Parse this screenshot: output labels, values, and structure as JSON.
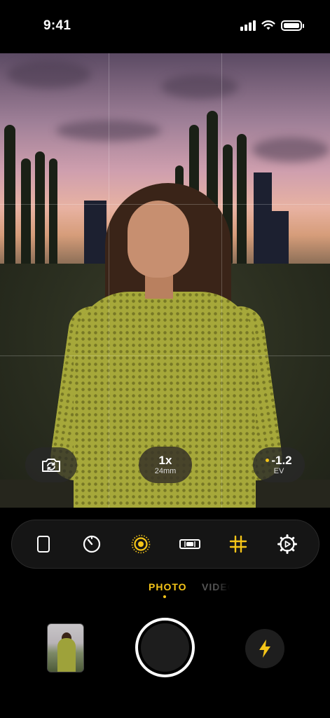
{
  "status_bar": {
    "time": "9:41",
    "icons": [
      "cellular-signal-icon",
      "wifi-icon",
      "battery-icon"
    ]
  },
  "viewfinder": {
    "grid_visible": true,
    "flip_camera_icon": "camera-flip-icon",
    "zoom": {
      "value": "1x",
      "focal_length": "24mm"
    },
    "exposure": {
      "value": "-1.2",
      "label": "EV",
      "indicator_color": "#f5c518"
    }
  },
  "toolbar": {
    "tools": [
      {
        "name": "aspect-ratio",
        "icon": "portrait-frame-icon",
        "active": false
      },
      {
        "name": "timer",
        "icon": "timer-icon",
        "active": false
      },
      {
        "name": "live-photo",
        "icon": "live-photo-icon",
        "active": true
      },
      {
        "name": "level",
        "icon": "level-icon",
        "active": false
      },
      {
        "name": "grid",
        "icon": "grid-icon",
        "active": true
      },
      {
        "name": "settings",
        "icon": "gear-icon",
        "active": false
      }
    ]
  },
  "modes": {
    "items": [
      "PHOTO",
      "VIDEO"
    ],
    "selected": "PHOTO"
  },
  "bottom_controls": {
    "thumbnail_icon": "last-photo-thumbnail",
    "shutter_icon": "shutter-button",
    "flash_icon": "flash-icon"
  },
  "colors": {
    "accent": "#f5c518",
    "background": "#000000",
    "toolbar_bg": "#151515"
  }
}
